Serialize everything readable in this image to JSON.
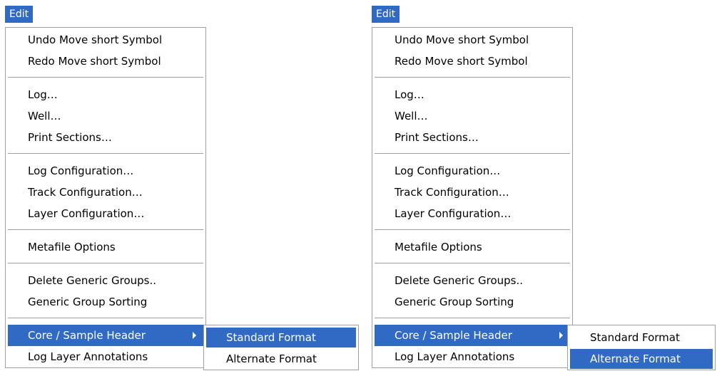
{
  "accent": "#316ac5",
  "menu_title": "Edit",
  "items": {
    "undo": "Undo Move short Symbol",
    "redo": "Redo Move short Symbol",
    "log": "Log…",
    "well": "Well…",
    "print_sections": "Print Sections…",
    "log_config": "Log Configuration…",
    "track_config": "Track Configuration…",
    "layer_config": "Layer Configuration…",
    "metafile": "Metafile Options",
    "delete_groups": "Delete Generic Groups..",
    "group_sorting": "Generic Group Sorting",
    "core_header": "Core / Sample Header",
    "log_layer_annotations": "Log Layer Annotations"
  },
  "submenu": {
    "standard": "Standard Format",
    "alternate": "Alternate Format"
  },
  "panels": [
    {
      "highlighted_submenu_item": "Standard Format"
    },
    {
      "highlighted_submenu_item": "Alternate Format"
    }
  ]
}
